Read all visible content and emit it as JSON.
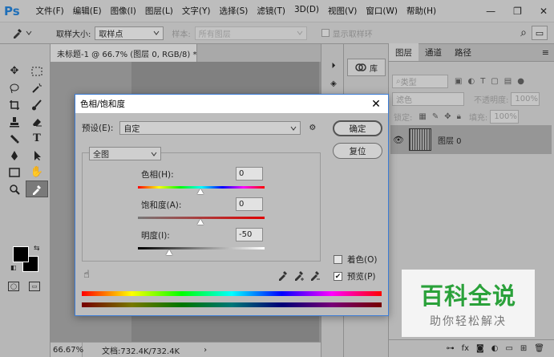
{
  "app": {
    "logo": "Ps",
    "menu": [
      "文件(F)",
      "编辑(E)",
      "图像(I)",
      "图层(L)",
      "文字(Y)",
      "选择(S)",
      "滤镜(T)",
      "3D(D)",
      "视图(V)",
      "窗口(W)",
      "帮助(H)"
    ],
    "window_controls": {
      "minimize": "—",
      "restore": "❐",
      "close": "✕"
    }
  },
  "options_bar": {
    "sample_size_label": "取样大小:",
    "sample_size_value": "取样点",
    "sample_label": "样本:",
    "sample_value": "所有图层",
    "show_ring_label": "显示取样环",
    "search_icon": "⌕",
    "workspace_icon": "▭"
  },
  "document": {
    "tab_title": "未标题-1 @ 66.7% (图层 0, RGB/8) *",
    "tab_close": "×",
    "zoom": "66.67%",
    "doc_info": "文档:732.4K/732.4K",
    "status_arrow": "›"
  },
  "library": {
    "label": "库"
  },
  "layers_panel": {
    "tabs": [
      "图层",
      "通道",
      "路径"
    ],
    "filter_type": "类型",
    "blend_mode": "滤色",
    "opacity_label": "不透明度:",
    "opacity_value": "100%",
    "lock_label": "锁定:",
    "fill_label": "填充:",
    "fill_value": "100%",
    "layer_name": "图层 0"
  },
  "dialog": {
    "title": "色相/饱和度",
    "preset_label": "预设(E):",
    "preset_value": "自定",
    "ok_label": "确定",
    "reset_label": "复位",
    "channel_value": "全图",
    "hue_label": "色相(H):",
    "hue_value": "0",
    "saturation_label": "饱和度(A):",
    "saturation_value": "0",
    "lightness_label": "明度(I):",
    "lightness_value": "-50",
    "colorize_label": "着色(O)",
    "colorize_checked": false,
    "preview_label": "预览(P)",
    "preview_checked": true
  },
  "watermark": {
    "title": "百科全说",
    "subtitle": "助你轻松解决"
  }
}
